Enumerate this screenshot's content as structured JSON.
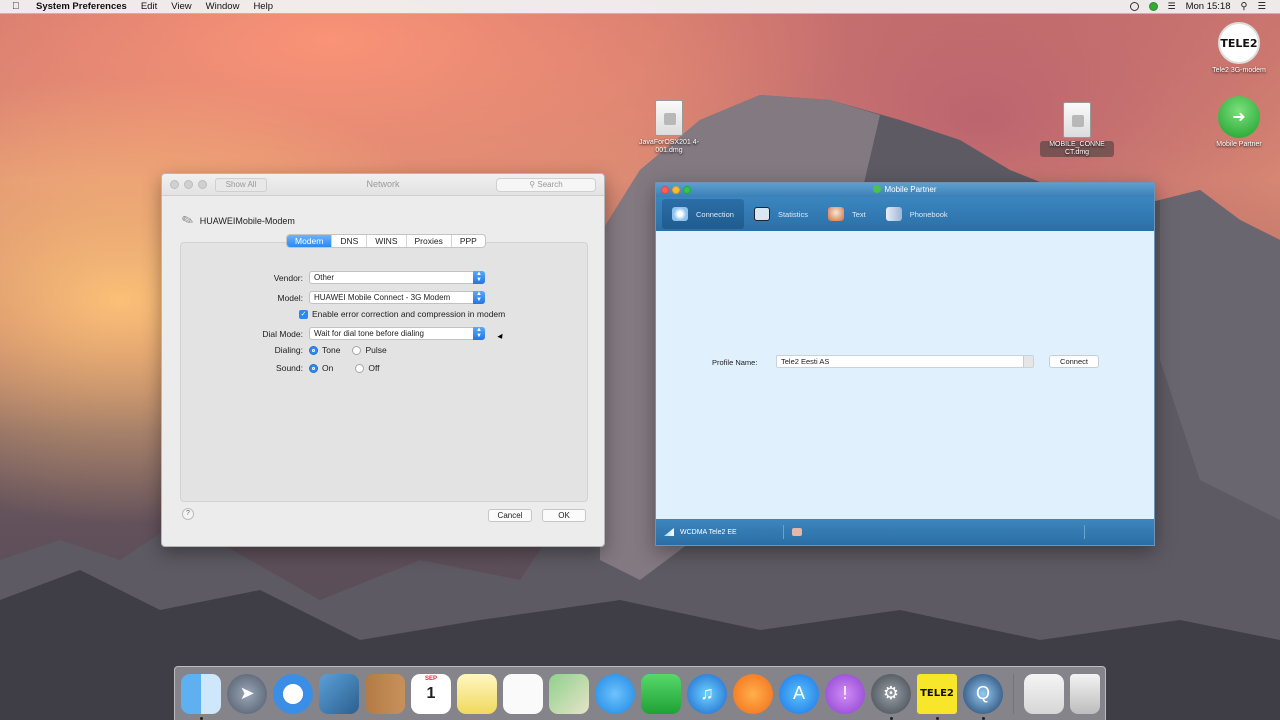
{
  "menubar": {
    "app": "System Preferences",
    "items": [
      "Edit",
      "View",
      "Window",
      "Help"
    ],
    "clock": "Mon 15:18"
  },
  "desktop": {
    "icons": [
      {
        "label": "JavaForOSX201 4-001.dmg"
      },
      {
        "label": "MOBILE_CONNE CT.dmg"
      },
      {
        "label": "Tele2 3G-modem"
      },
      {
        "label": "Mobile Partner"
      }
    ],
    "tele2_logo_text": "TELE2"
  },
  "network": {
    "title": "Network",
    "show_all": "Show All",
    "search_placeholder": "Search",
    "device": "HUAWEIMobile-Modem",
    "tabs": [
      "Modem",
      "DNS",
      "WINS",
      "Proxies",
      "PPP"
    ],
    "active_tab": "Modem",
    "vendor_label": "Vendor:",
    "vendor_value": "Other",
    "model_label": "Model:",
    "model_value": "HUAWEI Mobile Connect - 3G Modem",
    "error_correction": "Enable error correction and compression in modem",
    "dial_mode_label": "Dial Mode:",
    "dial_mode_value": "Wait for dial tone before dialing",
    "dialing_label": "Dialing:",
    "dialing_options": [
      "Tone",
      "Pulse"
    ],
    "sound_label": "Sound:",
    "sound_options": [
      "On",
      "Off"
    ],
    "help": "?",
    "cancel": "Cancel",
    "ok": "OK"
  },
  "mobile_partner": {
    "title": "Mobile Partner",
    "nav": [
      "Connection",
      "Statistics",
      "Text",
      "Phonebook"
    ],
    "profile_label": "Profile Name:",
    "profile_value": "Tele2 Eesti AS",
    "connect": "Connect",
    "status_network": "WCDMA  Tele2 EE"
  },
  "dock": {
    "calendar_month": "SEP",
    "calendar_day": "1",
    "tele2_label": "TELE2"
  },
  "colors": {
    "accent_blue": "#2a88f3",
    "mp_header": "#3b86bf",
    "mp_body": "#e0f0fc"
  }
}
